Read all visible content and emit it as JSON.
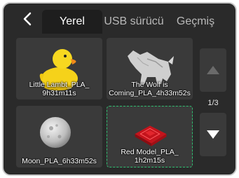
{
  "tabs": {
    "local": "Yerel",
    "usb": "USB sürücü",
    "history": "Geçmiş"
  },
  "files": [
    {
      "line1": "Little Lambt_PLA_",
      "line2": "9h31m11s"
    },
    {
      "line1": "The Wolf is",
      "line2": "Coming_PLA_4h33m52s"
    },
    {
      "line1": "Moon_PLA_6h33m52s",
      "line2": ""
    },
    {
      "line1": "Red Model_PLA_",
      "line2": "1h2m15s"
    }
  ],
  "pagination": {
    "indicator": "1/3"
  },
  "colors": {
    "background": "#2a2a2a",
    "card": "#3a3a3a",
    "selection": "#2fbf71",
    "arrow_up": "#6a6a6a",
    "arrow_down": "#ffffff"
  },
  "icons": {
    "back": "chevron-left-icon",
    "up": "triangle-up-icon",
    "down": "triangle-down-icon"
  }
}
